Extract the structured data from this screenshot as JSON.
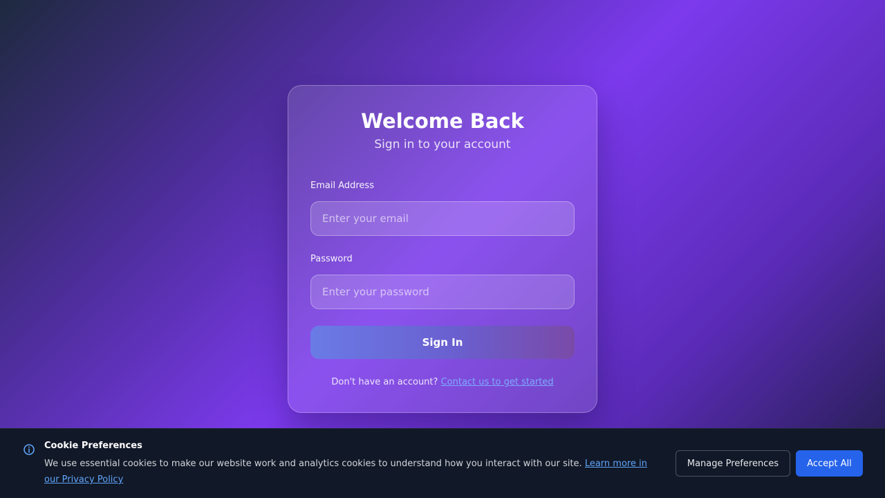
{
  "login": {
    "title": "Welcome Back",
    "subtitle": "Sign in to your account",
    "email_label": "Email Address",
    "email_placeholder": "Enter your email",
    "email_value": "",
    "password_label": "Password",
    "password_placeholder": "Enter your password",
    "password_value": "",
    "signin_label": "Sign In",
    "signup_prompt": "Don't have an account?",
    "signup_link": "Contact us to get started"
  },
  "cookie": {
    "icon": "info-icon",
    "title": "Cookie Preferences",
    "text": "We use essential cookies to make our website work and analytics cookies to understand how you interact with our site.",
    "link": "Learn more in our Privacy Policy",
    "manage_label": "Manage Preferences",
    "accept_label": "Accept All"
  },
  "colors": {
    "accent": "#2563eb",
    "link": "#60a5fa",
    "banner_bg": "#111827"
  }
}
